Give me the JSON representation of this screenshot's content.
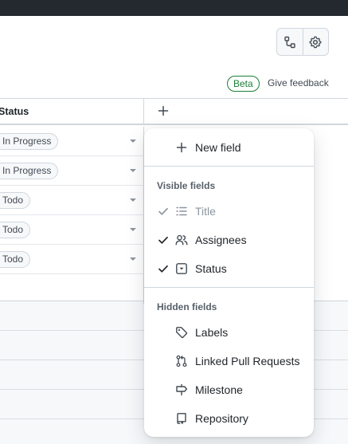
{
  "toolbar": {
    "workflows_icon": "workflow-icon",
    "settings_icon": "gear-icon"
  },
  "feedback": {
    "badge": "Beta",
    "link": "Give feedback"
  },
  "table": {
    "column_header": "Status",
    "add_column_icon": "plus-icon",
    "rows": [
      {
        "status": "In Progress"
      },
      {
        "status": "In Progress"
      },
      {
        "status": "Todo"
      },
      {
        "status": "Todo"
      },
      {
        "status": "Todo"
      }
    ]
  },
  "menu": {
    "new_field": "New field",
    "visible_heading": "Visible fields",
    "visible": [
      {
        "label": "Title",
        "icon": "list-icon",
        "checked": true,
        "disabled": true
      },
      {
        "label": "Assignees",
        "icon": "people-icon",
        "checked": true,
        "disabled": false
      },
      {
        "label": "Status",
        "icon": "single-select-icon",
        "checked": true,
        "disabled": false
      }
    ],
    "hidden_heading": "Hidden fields",
    "hidden": [
      {
        "label": "Labels",
        "icon": "tag-icon"
      },
      {
        "label": "Linked Pull Requests",
        "icon": "pull-request-icon"
      },
      {
        "label": "Milestone",
        "icon": "milestone-icon"
      },
      {
        "label": "Repository",
        "icon": "repo-icon"
      }
    ]
  },
  "colors": {
    "accent_green": "#1a7f37",
    "border": "#d0d7de",
    "topbar": "#24292f"
  }
}
